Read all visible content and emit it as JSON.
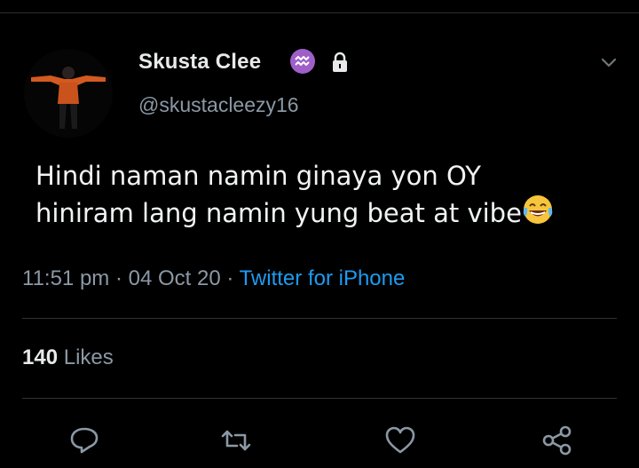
{
  "author": {
    "name": "Skusta Clee",
    "handle": "@skustacleezy16",
    "badges": [
      "aquarius-zodiac-icon",
      "lock-icon"
    ]
  },
  "tweet": {
    "lines": [
      "Hindi naman namin ginaya yon OY",
      "hiniram lang namin yung beat at vibe"
    ],
    "emoji": "face-with-tears-of-joy-icon"
  },
  "meta": {
    "time": "11:51 pm",
    "separator1": " · ",
    "date": "04 Oct 20",
    "separator2": " · ",
    "source": "Twitter for iPhone"
  },
  "stats": {
    "likes_count": "140",
    "likes_label": " Likes"
  },
  "actions": [
    "reply-icon",
    "retweet-icon",
    "like-icon",
    "share-icon"
  ],
  "colors": {
    "background": "#000000",
    "text": "#e7e9ea",
    "secondary": "#8b98a5",
    "link": "#1d9bf0",
    "badge": "#9f5fc9"
  }
}
